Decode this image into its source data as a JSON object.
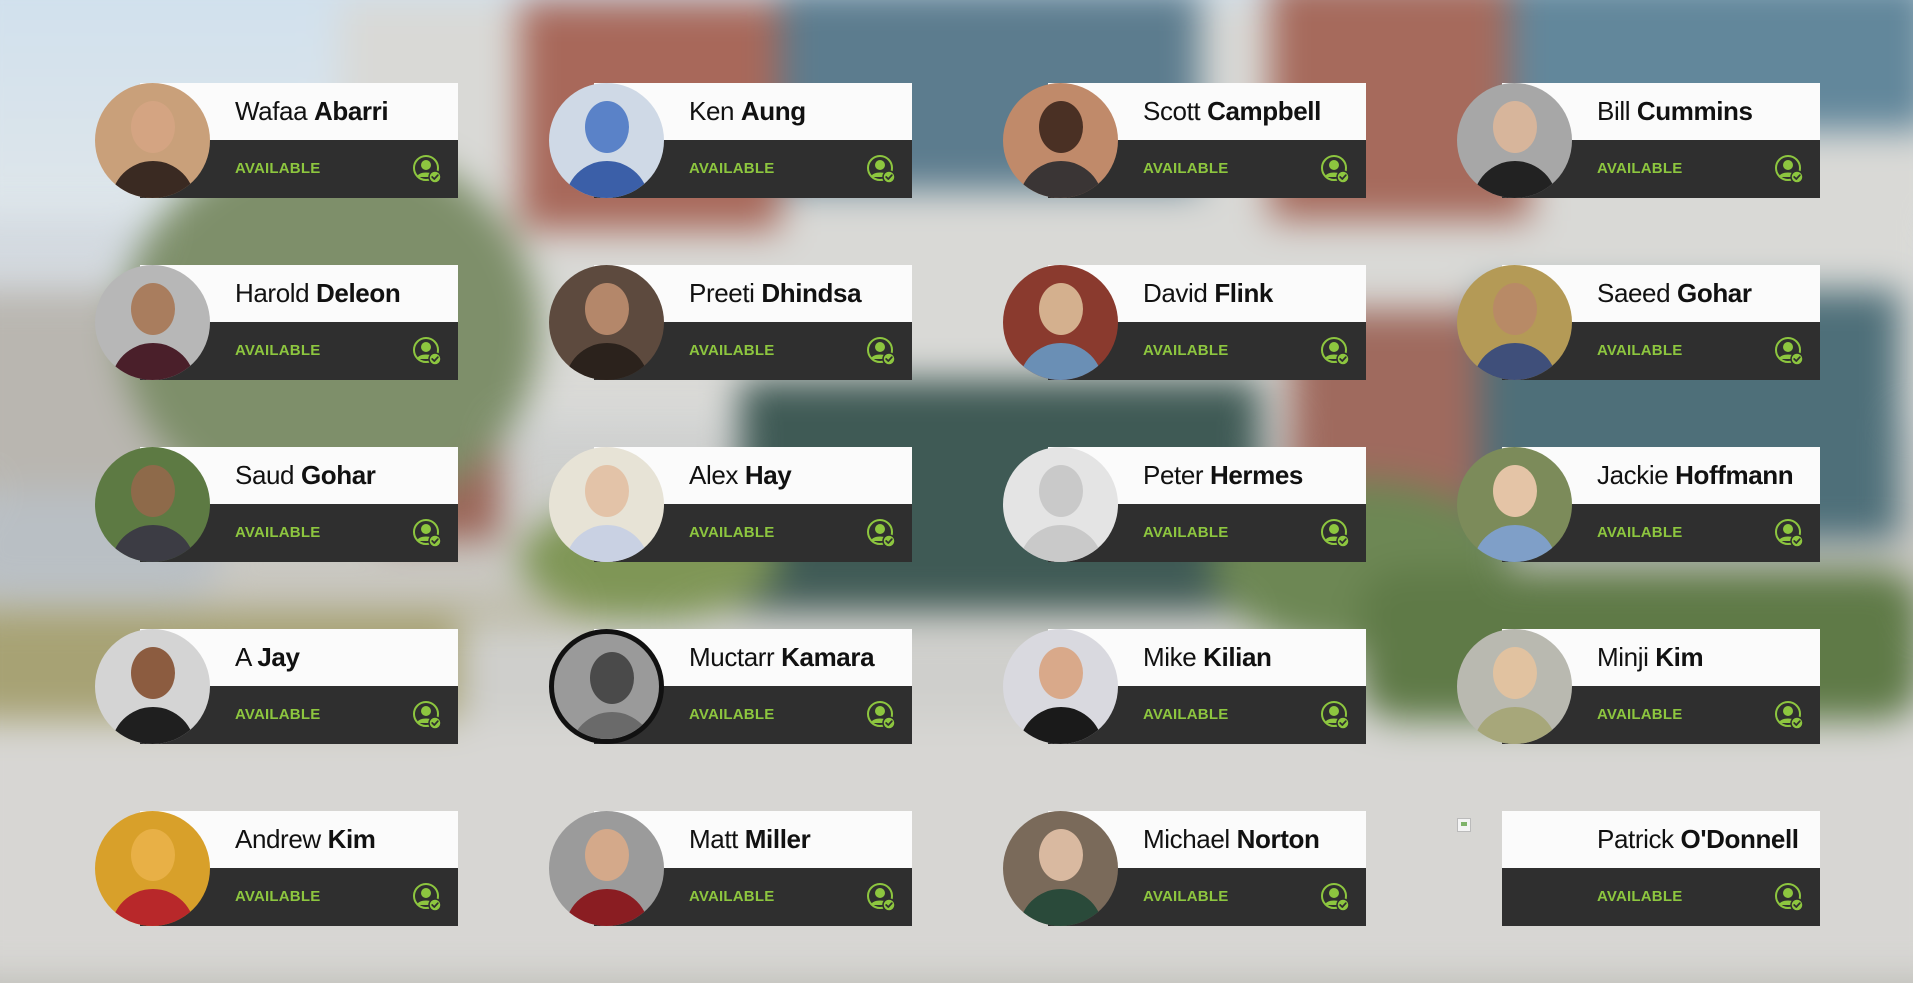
{
  "theme": {
    "accent": "#8dc63f",
    "name_bar_bg": "#fbfbfb",
    "status_bar_bg": "#2f2f2f"
  },
  "people": [
    {
      "first": "Wafaa",
      "last": "Abarri",
      "status": "AVAILABLE",
      "status_icon": "user-available-icon",
      "avatar": {
        "kind": "photo",
        "bg": "#c9a07a",
        "face": "#d4a482",
        "body": "#3a2a22"
      }
    },
    {
      "first": "Ken",
      "last": "Aung",
      "status": "AVAILABLE",
      "status_icon": "user-available-icon",
      "avatar": {
        "kind": "photo",
        "bg": "#cfd9e6",
        "face": "#5a82c8",
        "body": "#3b5fa8"
      }
    },
    {
      "first": "Scott",
      "last": "Campbell",
      "status": "AVAILABLE",
      "status_icon": "user-available-icon",
      "avatar": {
        "kind": "photo",
        "bg": "#c08a6a",
        "face": "#4a3024",
        "body": "#3a3535"
      }
    },
    {
      "first": "Bill",
      "last": "Cummins",
      "status": "AVAILABLE",
      "status_icon": "user-available-icon",
      "avatar": {
        "kind": "photo",
        "bg": "#a7a7a7",
        "face": "#d7b59b",
        "body": "#222222"
      }
    },
    {
      "first": "Harold",
      "last": "Deleon",
      "status": "AVAILABLE",
      "status_icon": "user-available-icon",
      "avatar": {
        "kind": "photo",
        "bg": "#b7b7b7",
        "face": "#a97d5e",
        "body": "#4a1f2a"
      }
    },
    {
      "first": "Preeti",
      "last": "Dhindsa",
      "status": "AVAILABLE",
      "status_icon": "user-available-icon",
      "avatar": {
        "kind": "photo",
        "bg": "#5d4a3e",
        "face": "#b4876a",
        "body": "#2b221c"
      }
    },
    {
      "first": "David",
      "last": "Flink",
      "status": "AVAILABLE",
      "status_icon": "user-available-icon",
      "avatar": {
        "kind": "photo",
        "bg": "#8a3a2e",
        "face": "#d4b08e",
        "body": "#6a8fb5"
      }
    },
    {
      "first": "Saeed",
      "last": "Gohar",
      "status": "AVAILABLE",
      "status_icon": "user-available-icon",
      "avatar": {
        "kind": "photo",
        "bg": "#b49a56",
        "face": "#b88a66",
        "body": "#3f4f7a"
      }
    },
    {
      "first": "Saud",
      "last": "Gohar",
      "status": "AVAILABLE",
      "status_icon": "user-available-icon",
      "avatar": {
        "kind": "photo",
        "bg": "#5d7a43",
        "face": "#8e6a4a",
        "body": "#3c3c44"
      }
    },
    {
      "first": "Alex",
      "last": "Hay",
      "status": "AVAILABLE",
      "status_icon": "user-available-icon",
      "avatar": {
        "kind": "photo",
        "bg": "#e7e3d6",
        "face": "#e3c3a8",
        "body": "#c9d1e3"
      }
    },
    {
      "first": "Peter",
      "last": "Hermes",
      "status": "AVAILABLE",
      "status_icon": "user-available-icon",
      "avatar": {
        "kind": "placeholder"
      }
    },
    {
      "first": "Jackie",
      "last": "Hoffmann",
      "status": "AVAILABLE",
      "status_icon": "user-available-icon",
      "avatar": {
        "kind": "photo",
        "bg": "#7c8b5a",
        "face": "#e4c4a6",
        "body": "#7f9fc8"
      }
    },
    {
      "first": "A",
      "last": "Jay",
      "status": "AVAILABLE",
      "status_icon": "user-available-icon",
      "avatar": {
        "kind": "photo",
        "bg": "#d4d4d4",
        "face": "#8c5c40",
        "body": "#1f1f1f"
      }
    },
    {
      "first": "Muctarr",
      "last": "Kamara",
      "status": "AVAILABLE",
      "status_icon": "user-available-icon",
      "avatar": {
        "kind": "photo-ring",
        "bg": "#9a9a9a",
        "face": "#4a4a4a",
        "body": "#6a6a6a"
      }
    },
    {
      "first": "Mike",
      "last": "Kilian",
      "status": "AVAILABLE",
      "status_icon": "user-available-icon",
      "avatar": {
        "kind": "photo",
        "bg": "#d9d9df",
        "face": "#d9a98a",
        "body": "#1a1a1a"
      }
    },
    {
      "first": "Minji",
      "last": "Kim",
      "status": "AVAILABLE",
      "status_icon": "user-available-icon",
      "avatar": {
        "kind": "photo",
        "bg": "#b9b9b0",
        "face": "#e1c2a0",
        "body": "#a7a77a"
      }
    },
    {
      "first": "Andrew",
      "last": "Kim",
      "status": "AVAILABLE",
      "status_icon": "user-available-icon",
      "avatar": {
        "kind": "photo",
        "bg": "#d8a02a",
        "face": "#e8b046",
        "body": "#b8282a"
      }
    },
    {
      "first": "Matt",
      "last": "Miller",
      "status": "AVAILABLE",
      "status_icon": "user-available-icon",
      "avatar": {
        "kind": "photo",
        "bg": "#9b9b9b",
        "face": "#d4a98a",
        "body": "#8a1d22"
      }
    },
    {
      "first": "Michael",
      "last": "Norton",
      "status": "AVAILABLE",
      "status_icon": "user-available-icon",
      "avatar": {
        "kind": "photo",
        "bg": "#7a6a5a",
        "face": "#d9b9a0",
        "body": "#2a4a3a"
      }
    },
    {
      "first": "Patrick",
      "last": "O'Donnell",
      "status": "AVAILABLE",
      "status_icon": "user-available-icon",
      "avatar": {
        "kind": "missing"
      }
    }
  ]
}
